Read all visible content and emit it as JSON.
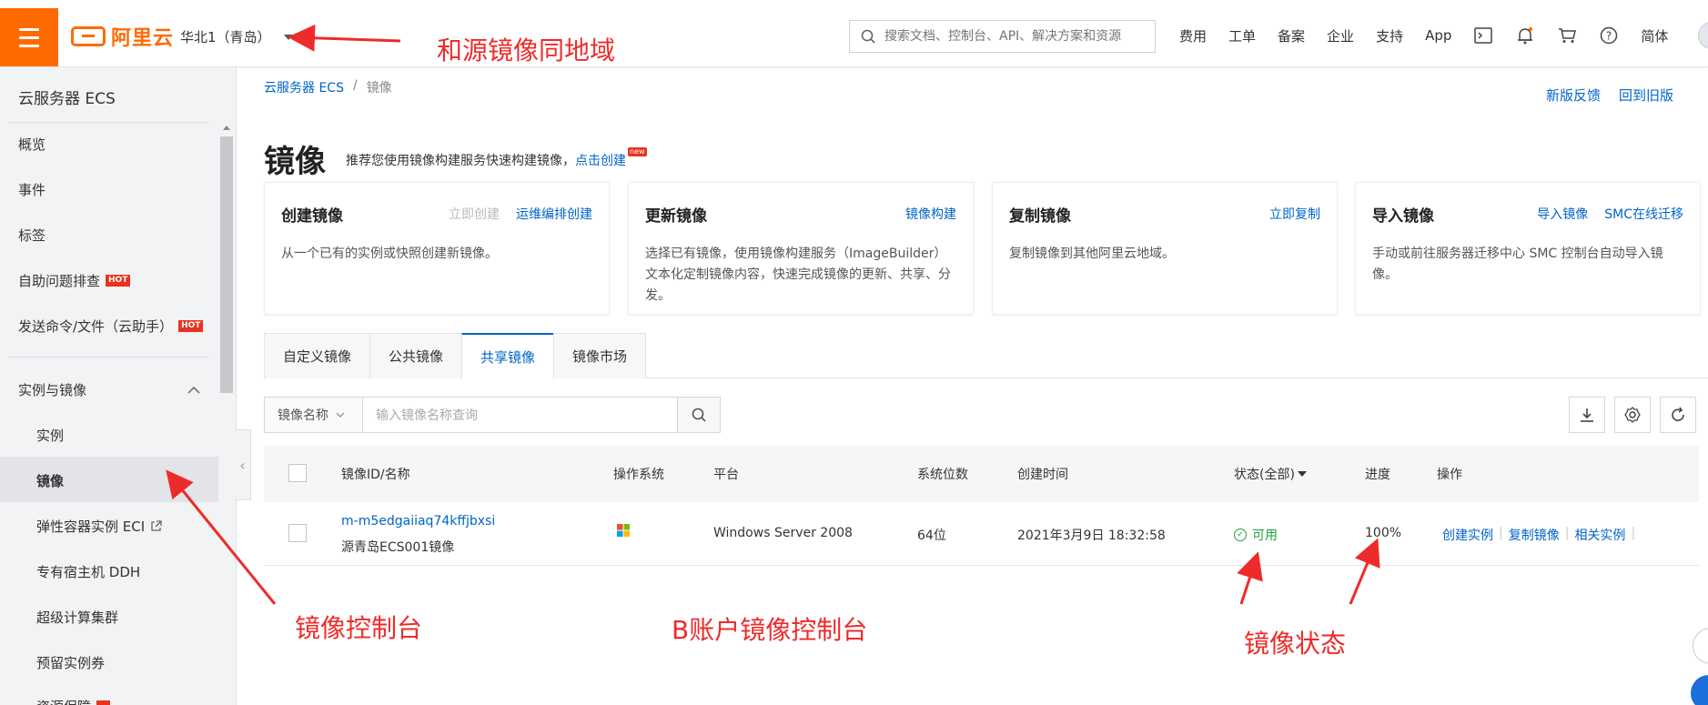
{
  "header": {
    "logo_text": "阿里云",
    "region": "华北1（青岛）",
    "search_placeholder": "搜索文档、控制台、API、解决方案和资源",
    "nav": [
      "费用",
      "工单",
      "备案",
      "企业",
      "支持",
      "App"
    ],
    "lang": "简体"
  },
  "sidebar": {
    "title": "云服务器 ECS",
    "items": [
      {
        "label": "概览"
      },
      {
        "label": "事件"
      },
      {
        "label": "标签"
      },
      {
        "label": "自助问题排查",
        "badge": "HOT"
      },
      {
        "label": "发送命令/文件（云助手）",
        "badge": "HOT"
      }
    ],
    "group": "实例与镜像",
    "sub_items": [
      {
        "label": "实例"
      },
      {
        "label": "镜像"
      },
      {
        "label": "弹性容器实例 ECI"
      },
      {
        "label": "专有宿主机 DDH"
      },
      {
        "label": "超级计算集群"
      },
      {
        "label": "预留实例券"
      },
      {
        "label": "资源保障"
      }
    ]
  },
  "breadcrumb": {
    "root": "云服务器 ECS",
    "current": "镜像"
  },
  "top_links": {
    "feedback": "新版反馈",
    "old": "回到旧版"
  },
  "page": {
    "title": "镜像",
    "tip": "推荐您使用镜像构建服务快速构建镜像，",
    "tip_link": "点击创建",
    "new_badge": "new"
  },
  "cards": [
    {
      "title": "创建镜像",
      "actions": [
        {
          "label": "立即创建",
          "disabled": true
        },
        {
          "label": "运维编排创建"
        }
      ],
      "desc": "从一个已有的实例或快照创建新镜像。"
    },
    {
      "title": "更新镜像",
      "actions": [
        {
          "label": "镜像构建"
        }
      ],
      "desc": "选择已有镜像，使用镜像构建服务（ImageBuilder）文本化定制镜像内容，快速完成镜像的更新、共享、分发。"
    },
    {
      "title": "复制镜像",
      "actions": [
        {
          "label": "立即复制"
        }
      ],
      "desc": "复制镜像到其他阿里云地域。"
    },
    {
      "title": "导入镜像",
      "actions": [
        {
          "label": "导入镜像"
        },
        {
          "label": "SMC在线迁移"
        }
      ],
      "desc": "手动或前往服务器迁移中心 SMC 控制台自动导入镜像。"
    }
  ],
  "tabs": [
    "自定义镜像",
    "公共镜像",
    "共享镜像",
    "镜像市场"
  ],
  "filter": {
    "select": "镜像名称",
    "placeholder": "输入镜像名称查询"
  },
  "table": {
    "columns": [
      "镜像ID/名称",
      "操作系统",
      "平台",
      "系统位数",
      "创建时间",
      "状态(全部)",
      "进度",
      "操作"
    ],
    "rows": [
      {
        "id": "m-m5edgaiiaq74kffjbxsi",
        "name": "源青岛ECS001镜像",
        "os_icon": "windows-icon",
        "platform": "Windows Server 2008",
        "bits": "64位",
        "created": "2021年3月9日 18:32:58",
        "status": "可用",
        "progress": "100%",
        "ops": [
          "创建实例",
          "复制镜像",
          "相关实例"
        ]
      }
    ]
  },
  "annotations": {
    "region": "和源镜像同地域",
    "console": "镜像控制台",
    "b_console": "B账户镜像控制台",
    "status": "镜像状态"
  },
  "colors": {
    "brand": "#ff6a00",
    "link": "#0064c8",
    "annotation": "#ee2b2b",
    "success": "#1fa33b"
  }
}
